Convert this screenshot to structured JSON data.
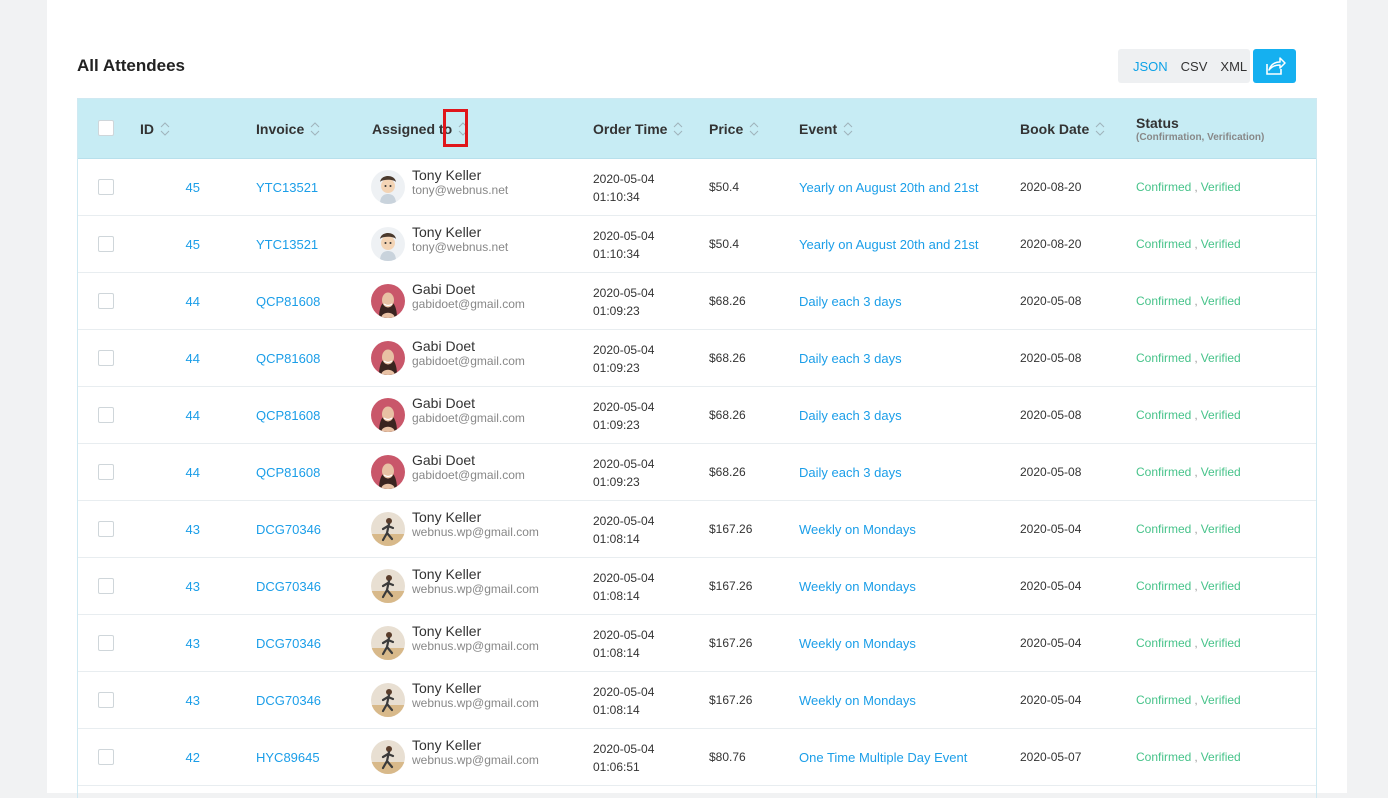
{
  "page": {
    "title": "All Attendees"
  },
  "export": {
    "json": "JSON",
    "csv": "CSV",
    "xml": "XML",
    "share_icon": "share-arrow-icon",
    "accent": "#15b0f0"
  },
  "table": {
    "headers": {
      "id": "ID",
      "invoice": "Invoice",
      "assigned": "Assigned to",
      "order_time": "Order Time",
      "price": "Price",
      "event": "Event",
      "book_date": "Book Date",
      "status": "Status",
      "status_sub": "(Confirmation, Verification)"
    },
    "header_bg": "#c7ecf4",
    "rows": [
      {
        "id": "45",
        "invoice": "YTC13521",
        "name": "Tony Keller",
        "email": "tony@webnus.net",
        "avatar": "cartoon",
        "date": "2020-05-04",
        "time": "01:10:34",
        "price": "$50.4",
        "event": "Yearly on August 20th and 21st",
        "book_date": "2020-08-20",
        "confirm": "Confirmed",
        "verify": "Verified"
      },
      {
        "id": "45",
        "invoice": "YTC13521",
        "name": "Tony Keller",
        "email": "tony@webnus.net",
        "avatar": "cartoon",
        "date": "2020-05-04",
        "time": "01:10:34",
        "price": "$50.4",
        "event": "Yearly on August 20th and 21st",
        "book_date": "2020-08-20",
        "confirm": "Confirmed",
        "verify": "Verified"
      },
      {
        "id": "44",
        "invoice": "QCP81608",
        "name": "Gabi Doet",
        "email": "gabidoet@gmail.com",
        "avatar": "woman",
        "date": "2020-05-04",
        "time": "01:09:23",
        "price": "$68.26",
        "event": "Daily each 3 days",
        "book_date": "2020-05-08",
        "confirm": "Confirmed",
        "verify": "Verified"
      },
      {
        "id": "44",
        "invoice": "QCP81608",
        "name": "Gabi Doet",
        "email": "gabidoet@gmail.com",
        "avatar": "woman",
        "date": "2020-05-04",
        "time": "01:09:23",
        "price": "$68.26",
        "event": "Daily each 3 days",
        "book_date": "2020-05-08",
        "confirm": "Confirmed",
        "verify": "Verified"
      },
      {
        "id": "44",
        "invoice": "QCP81608",
        "name": "Gabi Doet",
        "email": "gabidoet@gmail.com",
        "avatar": "woman",
        "date": "2020-05-04",
        "time": "01:09:23",
        "price": "$68.26",
        "event": "Daily each 3 days",
        "book_date": "2020-05-08",
        "confirm": "Confirmed",
        "verify": "Verified"
      },
      {
        "id": "44",
        "invoice": "QCP81608",
        "name": "Gabi Doet",
        "email": "gabidoet@gmail.com",
        "avatar": "woman",
        "date": "2020-05-04",
        "time": "01:09:23",
        "price": "$68.26",
        "event": "Daily each 3 days",
        "book_date": "2020-05-08",
        "confirm": "Confirmed",
        "verify": "Verified"
      },
      {
        "id": "43",
        "invoice": "DCG70346",
        "name": "Tony Keller",
        "email": "webnus.wp@gmail.com",
        "avatar": "runner",
        "date": "2020-05-04",
        "time": "01:08:14",
        "price": "$167.26",
        "event": "Weekly on Mondays",
        "book_date": "2020-05-04",
        "confirm": "Confirmed",
        "verify": "Verified"
      },
      {
        "id": "43",
        "invoice": "DCG70346",
        "name": "Tony Keller",
        "email": "webnus.wp@gmail.com",
        "avatar": "runner",
        "date": "2020-05-04",
        "time": "01:08:14",
        "price": "$167.26",
        "event": "Weekly on Mondays",
        "book_date": "2020-05-04",
        "confirm": "Confirmed",
        "verify": "Verified"
      },
      {
        "id": "43",
        "invoice": "DCG70346",
        "name": "Tony Keller",
        "email": "webnus.wp@gmail.com",
        "avatar": "runner",
        "date": "2020-05-04",
        "time": "01:08:14",
        "price": "$167.26",
        "event": "Weekly on Mondays",
        "book_date": "2020-05-04",
        "confirm": "Confirmed",
        "verify": "Verified"
      },
      {
        "id": "43",
        "invoice": "DCG70346",
        "name": "Tony Keller",
        "email": "webnus.wp@gmail.com",
        "avatar": "runner",
        "date": "2020-05-04",
        "time": "01:08:14",
        "price": "$167.26",
        "event": "Weekly on Mondays",
        "book_date": "2020-05-04",
        "confirm": "Confirmed",
        "verify": "Verified"
      },
      {
        "id": "42",
        "invoice": "HYC89645",
        "name": "Tony Keller",
        "email": "webnus.wp@gmail.com",
        "avatar": "runner",
        "date": "2020-05-04",
        "time": "01:06:51",
        "price": "$80.76",
        "event": "One Time Multiple Day Event",
        "book_date": "2020-05-07",
        "confirm": "Confirmed",
        "verify": "Verified"
      }
    ]
  },
  "colors": {
    "link": "#1b9ee8",
    "status": "#47c38a",
    "highlight": "#e0161b"
  }
}
